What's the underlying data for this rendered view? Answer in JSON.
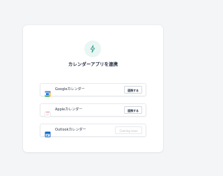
{
  "page": {
    "title": "カレンダーアプリを連携",
    "icon": "sparkle-icon",
    "accent_color": "#2f9c86"
  },
  "integrations": [
    {
      "label": "Googleカレンダー",
      "icon": "google-calendar-icon",
      "action": "連携する",
      "status": "available"
    },
    {
      "label": "Appleカレンダー",
      "icon": "apple-calendar-icon",
      "action": "連携する",
      "status": "available"
    },
    {
      "label": "Outlookカレンダー",
      "icon": "outlook-calendar-icon",
      "action": "Coming soon",
      "status": "disabled"
    }
  ]
}
